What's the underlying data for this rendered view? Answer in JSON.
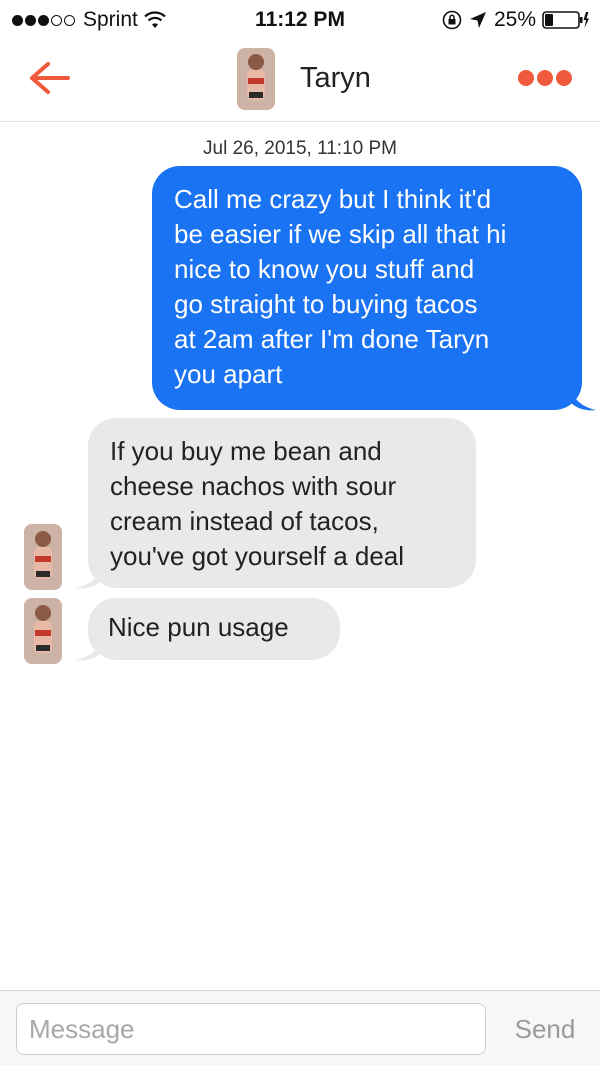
{
  "status_bar": {
    "carrier": "Sprint",
    "signal_bars_filled": 3,
    "signal_bars_total": 5,
    "time": "11:12 PM",
    "battery_percent": "25%",
    "battery_level": 0.25
  },
  "header": {
    "contact_name": "Taryn",
    "back_icon": "arrow-left-icon",
    "more_icon": "more-dots-icon",
    "accent_color": "#f05a3c"
  },
  "thread": {
    "timestamp": "Jul 26, 2015, 11:10 PM",
    "messages": [
      {
        "direction": "outgoing",
        "lines": [
          "Call me crazy but I think it'd",
          "be easier if we skip all that hi",
          "nice to know you stuff and",
          "go straight to buying tacos",
          "at 2am after I'm done Taryn",
          "you apart"
        ]
      },
      {
        "direction": "incoming",
        "lines": [
          "If you buy me bean and",
          "cheese nachos with sour",
          "cream instead of tacos,",
          "you've got yourself a deal"
        ]
      },
      {
        "direction": "incoming",
        "lines": [
          "Nice pun usage"
        ]
      }
    ],
    "outgoing_color": "#1a73f2",
    "incoming_color": "#e9e9eb"
  },
  "composer": {
    "placeholder": "Message",
    "value": "",
    "send_label": "Send"
  }
}
